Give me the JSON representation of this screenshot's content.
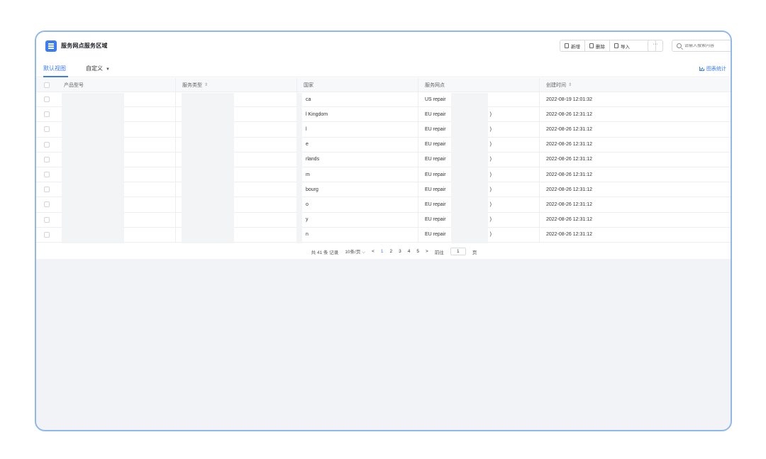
{
  "header": {
    "title": "服务网点服务区域",
    "toolbar": {
      "add": "新增",
      "delete": "删除",
      "import": "导入",
      "more": "···"
    },
    "search_placeholder": "请输入搜索内容"
  },
  "tabs": [
    {
      "label": "默认视图",
      "active": true
    },
    {
      "label": "自定义",
      "active": false
    }
  ],
  "chart_link": "图表统计",
  "columns": [
    "产品型号",
    "服务类型",
    "国家",
    "服务网点",
    "创建时间"
  ],
  "rows": [
    {
      "country": "ca",
      "outlet": "US repair",
      "outlet_suffix": "",
      "created": "2022-08-19 12:01:32"
    },
    {
      "country": "l Kingdom",
      "outlet": "EU repair",
      "outlet_suffix": ")",
      "created": "2022-08-26 12:31:12"
    },
    {
      "country": "l",
      "outlet": "EU repair",
      "outlet_suffix": ")",
      "created": "2022-08-26 12:31:12"
    },
    {
      "country": "e",
      "outlet": "EU repair",
      "outlet_suffix": ")",
      "created": "2022-08-26 12:31:12"
    },
    {
      "country": "rlands",
      "outlet": "EU repair",
      "outlet_suffix": ")",
      "created": "2022-08-26 12:31:12"
    },
    {
      "country": "m",
      "outlet": "EU repair",
      "outlet_suffix": ")",
      "created": "2022-08-26 12:31:12"
    },
    {
      "country": "bourg",
      "outlet": "EU repair",
      "outlet_suffix": ")",
      "created": "2022-08-26 12:31:12"
    },
    {
      "country": "o",
      "outlet": "EU repair",
      "outlet_suffix": ")",
      "created": "2022-08-26 12:31:12"
    },
    {
      "country": "y",
      "outlet": "EU repair",
      "outlet_suffix": ")",
      "created": "2022-08-26 12:31:12"
    },
    {
      "country": "n",
      "outlet": "EU repair",
      "outlet_suffix": ")",
      "created": "2022-08-26 12:31:12"
    }
  ],
  "pager": {
    "total": "共 41 条 记录",
    "page_size": "10条/页",
    "prev": "<",
    "pages": [
      "1",
      "2",
      "3",
      "4",
      "5"
    ],
    "next": ">",
    "goto_label": "前往",
    "goto_value": "1",
    "goto_suffix": "页"
  },
  "colors": {
    "accent": "#3b7cf5",
    "frame": "#8fb8ee",
    "background": "#f1f3f6"
  }
}
